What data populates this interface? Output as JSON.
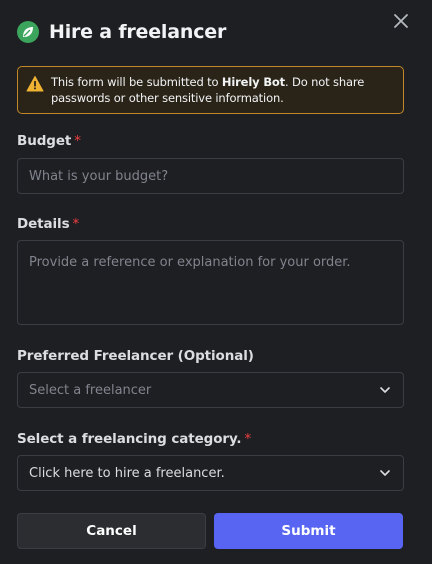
{
  "dialog": {
    "title": "Hire a freelancer",
    "close_icon": "close-icon",
    "app_icon": "leaf-icon",
    "accent": "#5865f2"
  },
  "warning": {
    "icon": "warning-icon",
    "text_before": "This form will be submitted to ",
    "bot_name": "Hirely Bot",
    "text_after": ". Do not share passwords or other sensitive information.",
    "border_color": "#c1872b"
  },
  "fields": {
    "budget": {
      "label": "Budget",
      "required_mark": "*",
      "placeholder": "What is your budget?"
    },
    "details": {
      "label": "Details",
      "required_mark": "*",
      "placeholder": "Provide a reference or explanation for your order."
    },
    "freelancer": {
      "label": "Preferred Freelancer (Optional)",
      "placeholder": "Select a freelancer"
    },
    "category": {
      "label": "Select a freelancing category.",
      "required_mark": "*",
      "value": "Click here to hire a freelancer."
    }
  },
  "buttons": {
    "cancel": "Cancel",
    "submit": "Submit"
  }
}
